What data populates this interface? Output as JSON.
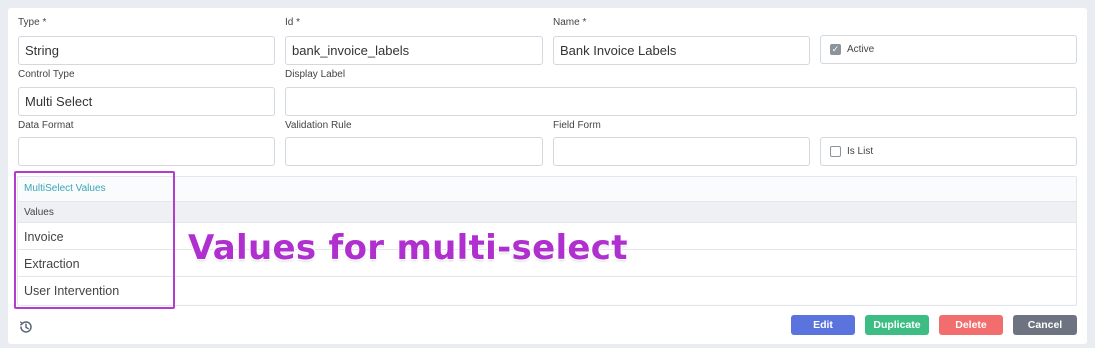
{
  "colors": {
    "edit": "#5b73dd",
    "duplicate": "#3dbd84",
    "delete": "#f26d6d",
    "cancel": "#6d7380",
    "annotation": "#b030cf",
    "link": "#3ba6b8"
  },
  "form": {
    "type": {
      "label": "Type *",
      "value": "String"
    },
    "id": {
      "label": "Id *",
      "value": "bank_invoice_labels"
    },
    "name": {
      "label": "Name *",
      "value": "Bank Invoice Labels"
    },
    "active": {
      "label": "Active",
      "checked": true
    },
    "control_type": {
      "label": "Control Type",
      "value": "Multi Select"
    },
    "display_label": {
      "label": "Display Label",
      "value": ""
    },
    "data_format": {
      "label": "Data Format",
      "value": ""
    },
    "validation_rule": {
      "label": "Validation Rule",
      "value": ""
    },
    "field_form": {
      "label": "Field Form",
      "value": ""
    },
    "is_list": {
      "label": "Is List",
      "checked": false
    }
  },
  "multiselect": {
    "title": "MultiSelect Values",
    "column_header": "Values",
    "values": [
      "Invoice",
      "Extraction",
      "User Intervention"
    ]
  },
  "annotation": {
    "text": "Values for multi-select"
  },
  "icons": {
    "history": "history-icon",
    "check": "check-icon"
  },
  "buttons": {
    "edit": "Edit",
    "duplicate": "Duplicate",
    "delete": "Delete",
    "cancel": "Cancel"
  }
}
